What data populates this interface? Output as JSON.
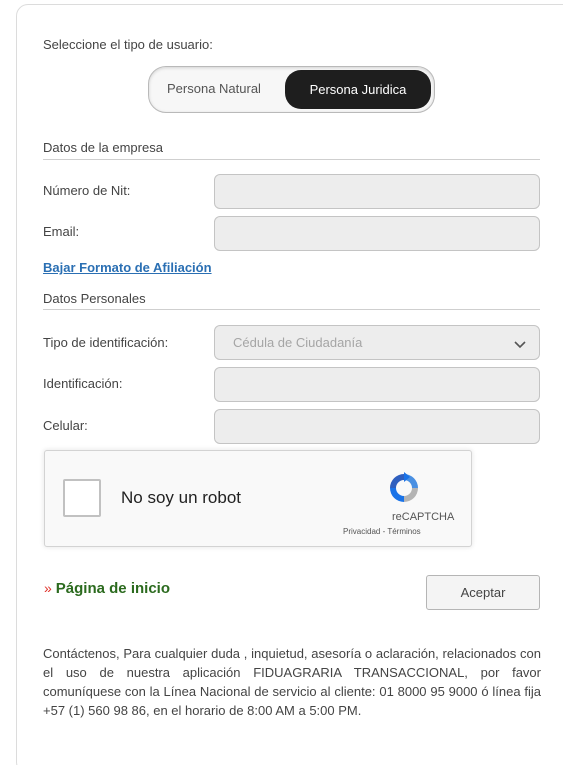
{
  "user_type": {
    "prompt": "Seleccione el tipo de usuario:",
    "options": [
      "Persona Natural",
      "Persona Juridica"
    ],
    "selected": "Persona Juridica"
  },
  "company": {
    "section_title": "Datos de la empresa",
    "nit_label": "Número de Nit:",
    "nit_value": "",
    "email_label": "Email:",
    "email_value": "",
    "download_link": "Bajar Formato de Afiliación"
  },
  "personal": {
    "section_title": "Datos Personales",
    "id_type_label": "Tipo de identificación:",
    "id_type_value": "Cédula de Ciudadanía",
    "id_label": "Identificación:",
    "id_value": "",
    "phone_label": "Celular:",
    "phone_value": ""
  },
  "captcha": {
    "checkbox_label": "No soy un robot",
    "brand": "reCAPTCHA",
    "terms": "Privacidad - Términos",
    "logo_icon": "recaptcha-icon"
  },
  "actions": {
    "home_chevrons": "»",
    "home_link": "Página de inicio",
    "accept_label": "Aceptar"
  },
  "footer": {
    "text": "Contáctenos, Para cualquier duda , inquietud, asesoría o aclaración, relacionados con el uso de nuestra aplicación FIDUAGRARIA TRANSACCIONAL, por favor comuníquese con la Línea Nacional de servicio al cliente: 01 8000 95 9000 ó línea fija +57 (1) 560 98 86, en el horario de 8:00 AM a 5:00 PM."
  },
  "colors": {
    "link": "#2a6fb3",
    "home_link": "#2b6a1e",
    "home_chevrons": "#e0332b",
    "toggle_selected": "#1e1e1e"
  }
}
